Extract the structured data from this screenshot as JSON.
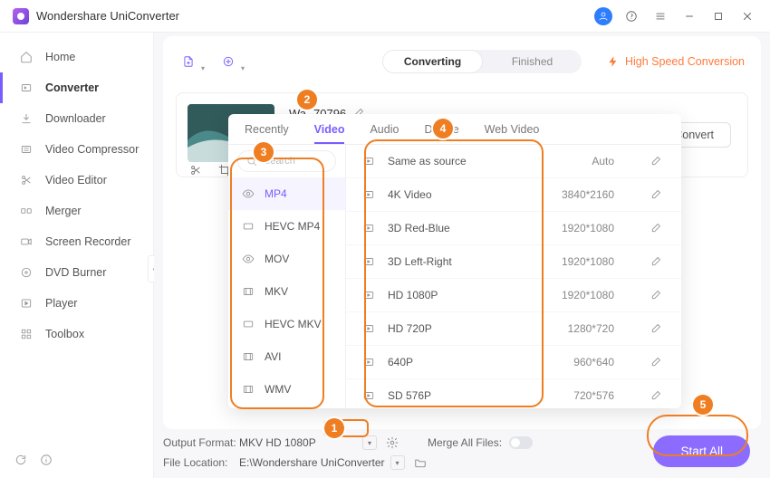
{
  "app_title": "Wondershare UniConverter",
  "sidebar": {
    "items": [
      {
        "label": "Home"
      },
      {
        "label": "Converter"
      },
      {
        "label": "Downloader"
      },
      {
        "label": "Video Compressor"
      },
      {
        "label": "Video Editor"
      },
      {
        "label": "Merger"
      },
      {
        "label": "Screen Recorder"
      },
      {
        "label": "DVD Burner"
      },
      {
        "label": "Player"
      },
      {
        "label": "Toolbox"
      }
    ]
  },
  "tabs": {
    "converting": "Converting",
    "finished": "Finished"
  },
  "high_speed": "High Speed Conversion",
  "file": {
    "truncated": "Wa",
    "rest": "70796",
    "name_full": "Wa... 70796"
  },
  "convert_btn": "Convert",
  "popup": {
    "tabs": [
      "Recently",
      "Video",
      "Audio",
      "Device",
      "Web Video"
    ],
    "search_placeholder": "Search",
    "formats": [
      "MP4",
      "HEVC MP4",
      "MOV",
      "MKV",
      "HEVC MKV",
      "AVI",
      "WMV"
    ],
    "presets": [
      {
        "label": "Same as source",
        "res": "Auto"
      },
      {
        "label": "4K Video",
        "res": "3840*2160"
      },
      {
        "label": "3D Red-Blue",
        "res": "1920*1080"
      },
      {
        "label": "3D Left-Right",
        "res": "1920*1080"
      },
      {
        "label": "HD 1080P",
        "res": "1920*1080"
      },
      {
        "label": "HD 720P",
        "res": "1280*720"
      },
      {
        "label": "640P",
        "res": "960*640"
      },
      {
        "label": "SD 576P",
        "res": "720*576"
      }
    ]
  },
  "bottom": {
    "output_label": "Output Format:",
    "output_value": "MKV HD 1080P",
    "location_label": "File Location:",
    "location_value": "E:\\Wondershare UniConverter",
    "merge_label": "Merge All Files:"
  },
  "start_all": "Start All",
  "annotations": [
    "1",
    "2",
    "3",
    "4",
    "5"
  ]
}
